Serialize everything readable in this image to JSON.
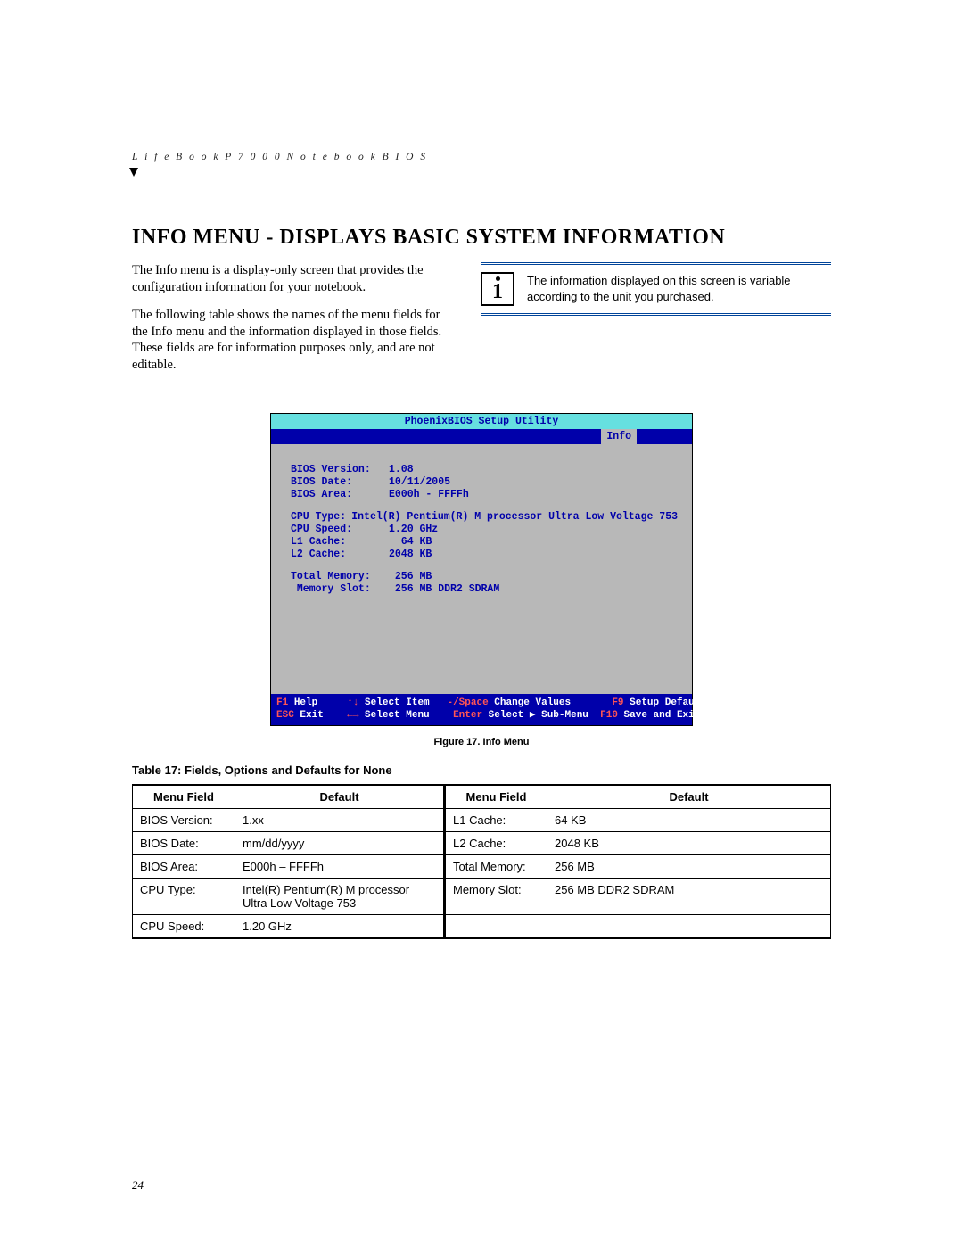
{
  "header_text": "L i f e B o o k   P 7 0 0 0   N o t e b o o k   B I O S",
  "title": "INFO MENU - DISPLAYS BASIC SYSTEM INFORMATION",
  "para1": "The Info menu is a display-only screen that provides the configuration information for your notebook.",
  "para2": "The following table shows the names of the menu fields for the Info menu and the information displayed in those fields. These fields are for information purposes only, and are not editable.",
  "infobox": "The information displayed on this screen is variable according to the unit you purchased.",
  "bios": {
    "title": "PhoenixBIOS Setup Utility",
    "active_tab": "Info",
    "group1": [
      {
        "label": "BIOS Version:",
        "value": "1.08"
      },
      {
        "label": "BIOS Date:",
        "value": "10/11/2005"
      },
      {
        "label": "BIOS Area:",
        "value": "E000h - FFFFh"
      }
    ],
    "group2": [
      {
        "label": "CPU Type:",
        "value": "Intel(R) Pentium(R) M processor Ultra Low Voltage 753"
      },
      {
        "label": "CPU Speed:",
        "value": "1.20 GHz"
      },
      {
        "label": "L1 Cache:",
        "value": "  64 KB"
      },
      {
        "label": "L2 Cache:",
        "value": "2048 KB"
      }
    ],
    "group3": [
      {
        "label": "Total Memory:",
        "value": " 256 MB"
      },
      {
        "label": " Memory Slot:",
        "value": " 256 MB DDR2 SDRAM"
      }
    ],
    "footer": {
      "r1": {
        "k1": "F1 ",
        "t1": "Help     ",
        "k2": "↑↓ ",
        "t2": "Select Item   ",
        "k3": "-/Space ",
        "t3": "Change Values       ",
        "k4": "F9 ",
        "t4": "Setup Defaults"
      },
      "r2": {
        "k1": "ESC ",
        "t1": "Exit    ",
        "k2": "←→ ",
        "t2": "Select Menu    ",
        "k3": "Enter ",
        "t3": "Select ▶ Sub-Menu  ",
        "k4": "F10 ",
        "t4": "Save and Exit"
      }
    }
  },
  "figure_caption": "Figure 17.  Info Menu",
  "table_caption": "Table 17: Fields, Options and Defaults for None",
  "table": {
    "headers": [
      "Menu Field",
      "Default",
      "Menu Field",
      "Default"
    ],
    "rows": [
      [
        "BIOS Version:",
        "1.xx",
        "L1 Cache:",
        "64 KB"
      ],
      [
        "BIOS Date:",
        "mm/dd/yyyy",
        "L2 Cache:",
        "2048 KB"
      ],
      [
        "BIOS Area:",
        "E000h – FFFFh",
        "Total Memory:",
        "256 MB"
      ],
      [
        "CPU Type:",
        "Intel(R) Pentium(R) M processor Ultra Low Voltage 753",
        "Memory Slot:",
        "256 MB DDR2 SDRAM"
      ],
      [
        "CPU Speed:",
        "1.20 GHz",
        "",
        ""
      ]
    ]
  },
  "page_number": "24"
}
